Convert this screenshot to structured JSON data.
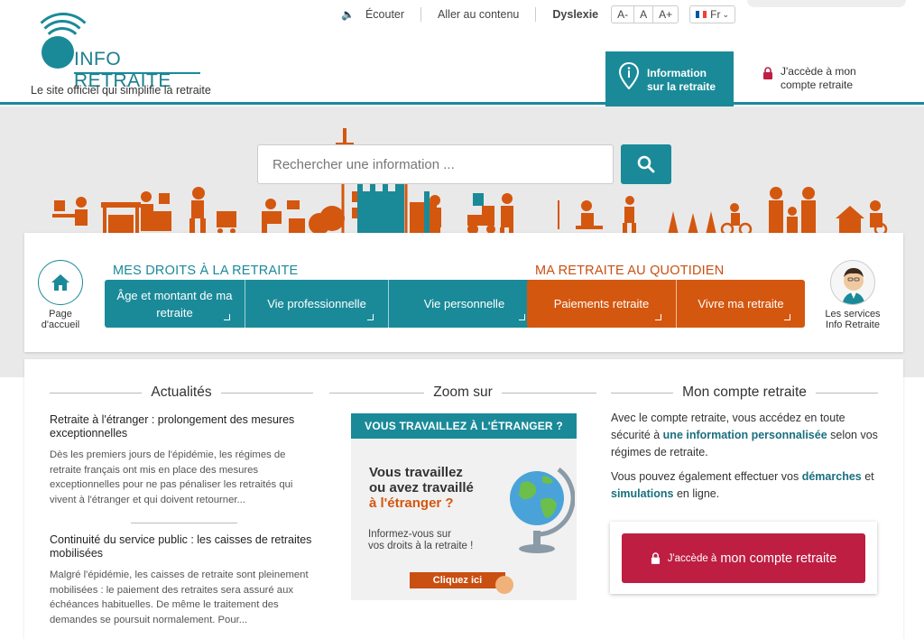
{
  "header": {
    "logo_text": "INFO RETRAITE",
    "tagline": "Le site officiel qui simplifie la retraite",
    "topbar": {
      "listen": "Écouter",
      "skip": "Aller au contenu",
      "dyslexia": "Dyslexie",
      "font_minus": "A-",
      "font_normal": "A",
      "font_plus": "A+",
      "lang": "Fr"
    },
    "info_tab": "Information\nsur la retraite",
    "account_link": "J'accède à mon\ncompte retraite"
  },
  "search": {
    "placeholder": "Rechercher une information ..."
  },
  "nav": {
    "home_label": "Page\nd'accueil",
    "droits_title": "MES DROITS À LA RETRAITE",
    "droits_items": [
      "Âge et montant de ma retraite",
      "Vie professionnelle",
      "Vie personnelle"
    ],
    "quotidien_title": "MA RETRAITE AU QUOTIDIEN",
    "quotidien_items": [
      "Paiements retraite",
      "Vivre ma retraite"
    ],
    "services_label": "Les services\nInfo Retraite"
  },
  "actualites": {
    "title": "Actualités",
    "items": [
      {
        "title": "Retraite à l'étranger : prolongement des mesures exceptionnelles",
        "body": "Dès les premiers jours de l'épidémie, les régimes de retraite français ont mis en place des mesures exceptionnelles pour ne pas pénaliser les retraités qui vivent à l'étranger et qui doivent retourner..."
      },
      {
        "title": "Continuité du service public : les caisses de retraites mobilisées",
        "body": "Malgré l'épidémie, les caisses de retraite sont pleinement mobilisées : le paiement des retraites sera assuré aux échéances habituelles. De même le traitement des demandes se poursuit normalement. Pour..."
      }
    ]
  },
  "zoom": {
    "title": "Zoom sur",
    "banner": "VOUS TRAVAILLEZ À L'ÉTRANGER ?",
    "line1": "Vous travaillez",
    "line2": "ou avez travaillé",
    "line3": "à l'étranger ?",
    "sub1": "Informez-vous sur",
    "sub2": "vos droits à la retraite !",
    "cta": "Cliquez ici"
  },
  "compte": {
    "title": "Mon compte retraite",
    "p1_a": "Avec le compte retraite, vous accédez en toute sécurité à ",
    "p1_b": "une information personnalisée",
    "p1_c": " selon vos régimes de retraite.",
    "p2_a": "Vous pouvez également effectuer vos ",
    "p2_b": "démarches",
    "p2_c": " et ",
    "p2_d": "simulations",
    "p2_e": " en ligne.",
    "btn_small": "J'accède à",
    "btn_big": "mon compte retraite"
  },
  "colors": {
    "teal": "#1a8a99",
    "orange": "#d4570f",
    "crimson": "#be1e42"
  }
}
